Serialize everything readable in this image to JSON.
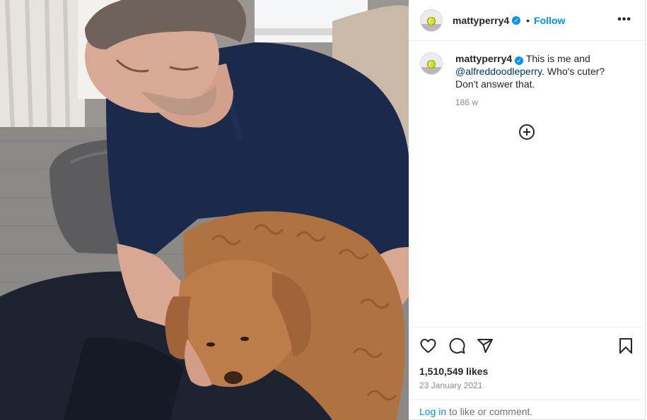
{
  "post": {
    "image_alt": "Man in navy t-shirt holding a golden doodle puppy",
    "username": "mattyperry4",
    "verified_mark": "✓",
    "separator": "•",
    "follow_label": "Follow",
    "more_label": "•••",
    "caption_user": "mattyperry4",
    "caption_line1": " This is me and",
    "caption_mention": "@alfreddoodleperry",
    "caption_line2": ". Who's cuter?",
    "caption_line3": "Don't answer that.",
    "caption_time": "186 w",
    "likes": "1,510,549 likes",
    "date": "23 January 2021",
    "login_link": "Log in",
    "login_text": " to like or comment."
  },
  "icons": {
    "like": "heart-icon",
    "comment": "comment-icon",
    "share": "send-icon",
    "save": "bookmark-icon",
    "load_more": "plus-circle-icon",
    "options": "more-options-icon"
  },
  "colors": {
    "accent": "#0095f6",
    "mention": "#00376b",
    "muted": "#8e8e8e",
    "text": "#262626",
    "border": "#dbdbdb"
  }
}
